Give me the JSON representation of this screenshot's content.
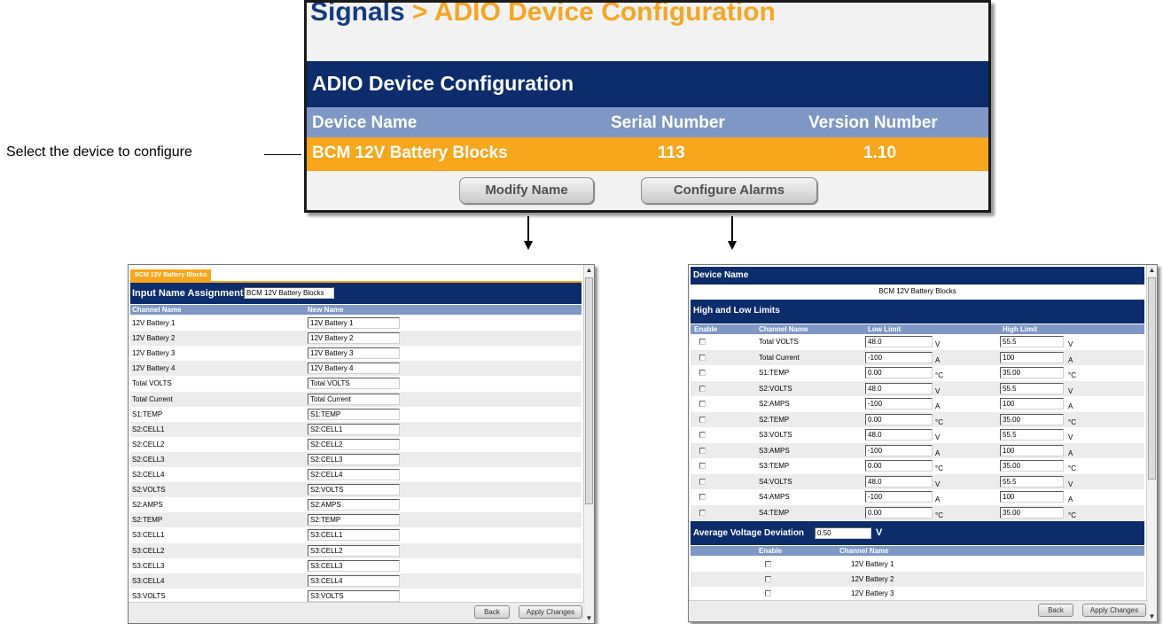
{
  "header": {
    "breadcrumb_root": "Signals",
    "breadcrumb_sep": " > ",
    "breadcrumb_page": "ADIO Device Configuration",
    "panel_title": "ADIO Device Configuration"
  },
  "device_table": {
    "columns": [
      "Device Name",
      "Serial Number",
      "Version Number"
    ],
    "row": {
      "name": "BCM 12V Battery Blocks",
      "serial": "113",
      "version": "1.10"
    },
    "buttons": {
      "modify": "Modify Name",
      "alarms": "Configure Alarms"
    }
  },
  "annotation": {
    "caption": "Select the device to configure"
  },
  "name_window": {
    "tab": "BCM 12V Battery Blocks",
    "title": "Input Name Assignment",
    "title_value": "BCM 12V Battery Blocks",
    "col_channel": "Channel Name",
    "col_new": "New Name",
    "rows": [
      {
        "channel": "12V Battery 1",
        "new_name": "12V Battery 1"
      },
      {
        "channel": "12V Battery 2",
        "new_name": "12V Battery 2"
      },
      {
        "channel": "12V Battery 3",
        "new_name": "12V Battery 3"
      },
      {
        "channel": "12V Battery 4",
        "new_name": "12V Battery 4"
      },
      {
        "channel": "Total VOLTS",
        "new_name": "Total VOLTS"
      },
      {
        "channel": "Total Current",
        "new_name": "Total Current"
      },
      {
        "channel": "S1:TEMP",
        "new_name": "S1:TEMP"
      },
      {
        "channel": "S2:CELL1",
        "new_name": "S2:CELL1"
      },
      {
        "channel": "S2:CELL2",
        "new_name": "S2:CELL2"
      },
      {
        "channel": "S2:CELL3",
        "new_name": "S2:CELL3"
      },
      {
        "channel": "S2:CELL4",
        "new_name": "S2:CELL4"
      },
      {
        "channel": "S2:VOLTS",
        "new_name": "S2:VOLTS"
      },
      {
        "channel": "S2:AMPS",
        "new_name": "S2:AMPS"
      },
      {
        "channel": "S2:TEMP",
        "new_name": "S2:TEMP"
      },
      {
        "channel": "S3:CELL1",
        "new_name": "S3:CELL1"
      },
      {
        "channel": "S3:CELL2",
        "new_name": "S3:CELL2"
      },
      {
        "channel": "S3:CELL3",
        "new_name": "S3:CELL3"
      },
      {
        "channel": "S3:CELL4",
        "new_name": "S3:CELL4"
      },
      {
        "channel": "S3:VOLTS",
        "new_name": "S3:VOLTS"
      }
    ],
    "back": "Back",
    "apply": "Apply Changes"
  },
  "alarm_window": {
    "device_name_head": "Device Name",
    "device_name": "BCM 12V Battery Blocks",
    "limits_head": "High and Low Limits",
    "col_enable": "Enable",
    "col_channel": "Channel Name",
    "col_low": "Low Limit",
    "col_high": "High Limit",
    "rows": [
      {
        "channel": "Total VOLTS",
        "low": "48.0",
        "low_unit": "V",
        "high": "55.5",
        "high_unit": "V"
      },
      {
        "channel": "Total Current",
        "low": "-100",
        "low_unit": "A",
        "high": "100",
        "high_unit": "A"
      },
      {
        "channel": "S1:TEMP",
        "low": "0.00",
        "low_unit": "°C",
        "high": "35.00",
        "high_unit": "°C"
      },
      {
        "channel": "S2:VOLTS",
        "low": "48.0",
        "low_unit": "V",
        "high": "55.5",
        "high_unit": "V"
      },
      {
        "channel": "S2:AMPS",
        "low": "-100",
        "low_unit": "A",
        "high": "100",
        "high_unit": "A"
      },
      {
        "channel": "S2:TEMP",
        "low": "0.00",
        "low_unit": "°C",
        "high": "35.00",
        "high_unit": "°C"
      },
      {
        "channel": "S3:VOLTS",
        "low": "48.0",
        "low_unit": "V",
        "high": "55.5",
        "high_unit": "V"
      },
      {
        "channel": "S3:AMPS",
        "low": "-100",
        "low_unit": "A",
        "high": "100",
        "high_unit": "A"
      },
      {
        "channel": "S3:TEMP",
        "low": "0.00",
        "low_unit": "°C",
        "high": "35.00",
        "high_unit": "°C"
      },
      {
        "channel": "S4:VOLTS",
        "low": "48.0",
        "low_unit": "V",
        "high": "55.5",
        "high_unit": "V"
      },
      {
        "channel": "S4:AMPS",
        "low": "-100",
        "low_unit": "A",
        "high": "100",
        "high_unit": "A"
      },
      {
        "channel": "S4:TEMP",
        "low": "0.00",
        "low_unit": "°C",
        "high": "35.00",
        "high_unit": "°C"
      }
    ],
    "avg_label": "Average Voltage Deviation",
    "avg_value": "0.50",
    "avg_unit": "V",
    "avg_col_enable": "Enable",
    "avg_col_channel": "Channel Name",
    "avg_rows": [
      "12V Battery 1",
      "12V Battery 2",
      "12V Battery 3"
    ],
    "back": "Back",
    "apply": "Apply Changes"
  },
  "colors": {
    "navy": "#0c2c6c",
    "steel": "#7e97c4",
    "orange": "#f8a61c",
    "title_blue": "#143c7e",
    "title_orange": "#f5a623"
  },
  "icons": [
    "down-arrow-icon",
    "checkbox-icon",
    "scroll-up-icon",
    "scroll-down-icon"
  ]
}
